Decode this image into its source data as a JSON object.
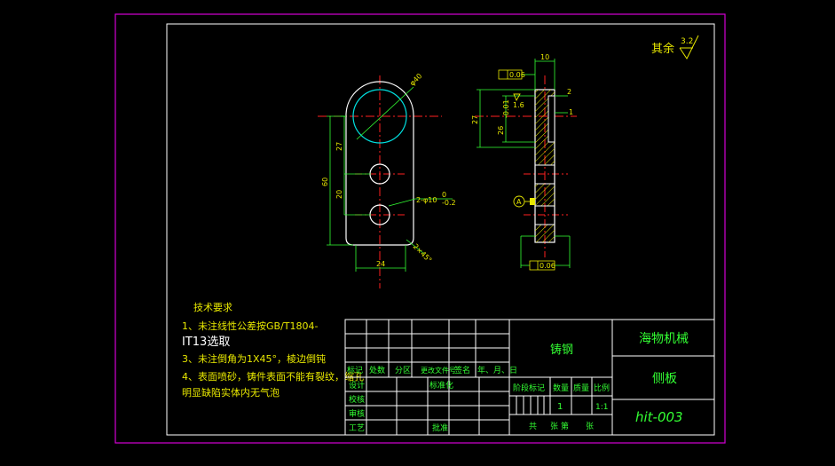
{
  "colors": {
    "background": "#000000",
    "outer_border": "#d400d4",
    "frame": "#ffffff",
    "geometry": "#ffffff",
    "centerline": "#ff2020",
    "dimension": "#33ff33",
    "dimension_text": "#e8e800",
    "hatch": "#e8e800",
    "hole": "#00e0e0",
    "title_text": "#33ff33"
  },
  "surface_finish": {
    "label": "其余",
    "value": "3.2"
  },
  "front_view": {
    "dims": {
      "circle_dia": "φ40",
      "upper_span": "27",
      "lower_span": "20",
      "total_height": "60",
      "width": "24",
      "holes": "2-φ10",
      "hole_tol_upper": "0",
      "hole_tol_lower": "-0.2",
      "chamfer": "2×45°"
    }
  },
  "side_view": {
    "dims": {
      "thickness": "10",
      "offset_2": "2",
      "offset_1": "1",
      "height_27": "27",
      "height_26": "26",
      "height_26_tol": "-0.01",
      "roughness": "1.6",
      "tolerance_top": "0.06",
      "tolerance_bottom": "0.06",
      "datum": "A"
    }
  },
  "technical_requirements": {
    "title": "技术要求",
    "lines": [
      "1、未注线性公差按GB/T1804-",
      "IT13选取",
      "3、未注倒角为1X45°，棱边倒钝",
      "4、表面喷砂，铸件表面不能有裂纹，缩孔",
      "明显缺陷实体内无气泡"
    ]
  },
  "title_block": {
    "material": "铸钢",
    "company": "海物机械",
    "part_name": "侧板",
    "drawing_no": "hit-003",
    "row_headers": [
      "标记",
      "处数",
      "分区",
      "更改文件号",
      "签名",
      "年、月、日"
    ],
    "row_design": "设计",
    "row_standard": "标准化",
    "row_check": "校核",
    "row_review": "审核",
    "row_process": "工艺",
    "row_approve": "批准",
    "stage_mark": "阶段标记",
    "weight": "质量",
    "quantity": "数量",
    "scale": "比例",
    "quantity_value": "1",
    "scale_value": "1:1",
    "sheets_total": "共",
    "sheet_no": "张 第",
    "sheets_end": "张"
  }
}
